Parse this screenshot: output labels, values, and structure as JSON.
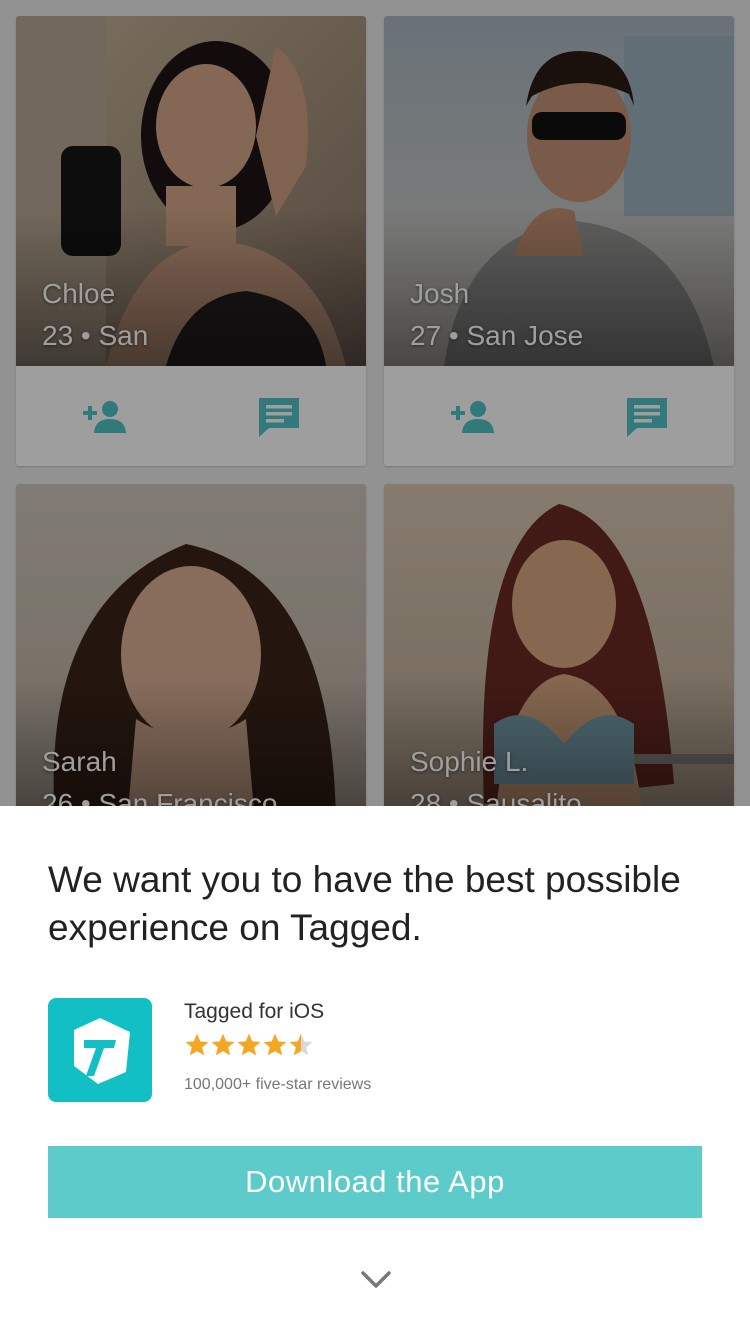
{
  "profiles": [
    {
      "name": "Chloe",
      "meta": "23 • San"
    },
    {
      "name": "Josh",
      "meta": "27 • San Jose"
    },
    {
      "name": "Sarah",
      "meta": "26 • San Francisco"
    },
    {
      "name": "Sophie L.",
      "meta": "28 • Sausalito"
    }
  ],
  "icons": {
    "add_friend": "add-friend-icon",
    "message": "message-icon",
    "chevron": "chevron-down-icon",
    "app": "tagged-logo-icon",
    "star": "star-icon"
  },
  "colors": {
    "accent": "#4fc3c6",
    "button": "#5ccbca",
    "app_icon": "#11bfc4",
    "star": "#f5a623"
  },
  "promo": {
    "headline": "We want you to have the best possible experience on Tagged.",
    "app_name": "Tagged for iOS",
    "rating": 4.5,
    "reviews": "100,000+ five-star reviews",
    "download_label": "Download the App"
  }
}
